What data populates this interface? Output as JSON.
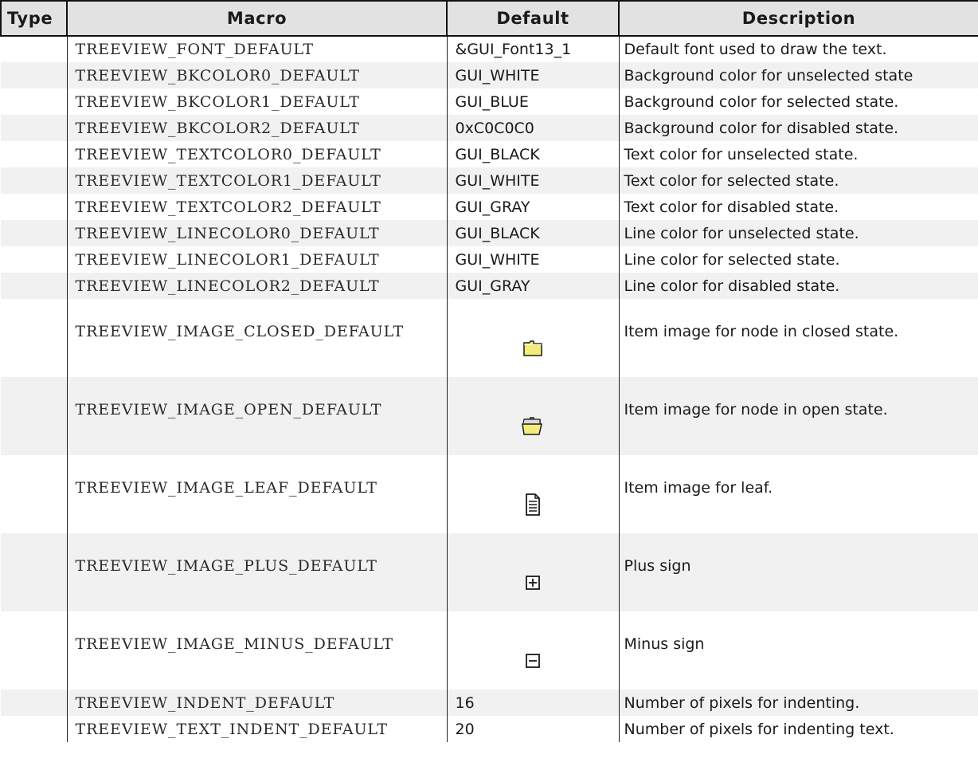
{
  "headers": {
    "type": "Type",
    "macro": "Macro",
    "default": "Default",
    "description": "Description"
  },
  "rows": [
    {
      "type": "",
      "macro": "TREEVIEW_FONT_DEFAULT",
      "default": "&GUI_Font13_1",
      "description": "Default font used to draw the text."
    },
    {
      "type": "",
      "macro": "TREEVIEW_BKCOLOR0_DEFAULT",
      "default": "GUI_WHITE",
      "description": "Background color for unselected state"
    },
    {
      "type": "",
      "macro": "TREEVIEW_BKCOLOR1_DEFAULT",
      "default": "GUI_BLUE",
      "description": "Background color for selected state."
    },
    {
      "type": "",
      "macro": "TREEVIEW_BKCOLOR2_DEFAULT",
      "default": "0xC0C0C0",
      "description": "Background color for disabled state."
    },
    {
      "type": "",
      "macro": "TREEVIEW_TEXTCOLOR0_DEFAULT",
      "default": "GUI_BLACK",
      "description": "Text color for unselected state."
    },
    {
      "type": "",
      "macro": "TREEVIEW_TEXTCOLOR1_DEFAULT",
      "default": "GUI_WHITE",
      "description": "Text color for selected state."
    },
    {
      "type": "",
      "macro": "TREEVIEW_TEXTCOLOR2_DEFAULT",
      "default": "GUI_GRAY",
      "description": "Text color for disabled state."
    },
    {
      "type": "",
      "macro": "TREEVIEW_LINECOLOR0_DEFAULT",
      "default": "GUI_BLACK",
      "description": "Line color for unselected state."
    },
    {
      "type": "",
      "macro": "TREEVIEW_LINECOLOR1_DEFAULT",
      "default": "GUI_WHITE",
      "description": "Line color for selected state."
    },
    {
      "type": "",
      "macro": "TREEVIEW_LINECOLOR2_DEFAULT",
      "default": "GUI_GRAY",
      "description": "Line color for disabled state."
    },
    {
      "type": "",
      "macro": "TREEVIEW_IMAGE_CLOSED_DEFAULT",
      "default_icon": "closed-folder-icon",
      "description": "Item image for node in closed state."
    },
    {
      "type": "",
      "macro": "TREEVIEW_IMAGE_OPEN_DEFAULT",
      "default_icon": "open-folder-icon",
      "description": "Item image for node in open state."
    },
    {
      "type": "",
      "macro": "TREEVIEW_IMAGE_LEAF_DEFAULT",
      "default_icon": "leaf-document-icon",
      "description": "Item image for leaf."
    },
    {
      "type": "",
      "macro": "TREEVIEW_IMAGE_PLUS_DEFAULT",
      "default_icon": "plus-box-icon",
      "description": "Plus sign"
    },
    {
      "type": "",
      "macro": "TREEVIEW_IMAGE_MINUS_DEFAULT",
      "default_icon": "minus-box-icon",
      "description": "Minus sign"
    },
    {
      "type": "",
      "macro": "TREEVIEW_INDENT_DEFAULT",
      "default": "16",
      "description": "Number of pixels for indenting."
    },
    {
      "type": "",
      "macro": "TREEVIEW_TEXT_INDENT_DEFAULT",
      "default": "20",
      "description": "Number of pixels for indenting text."
    }
  ],
  "colors": {
    "header_bg": "#e2e2e2",
    "alt_row_bg": "#f1f1f1",
    "folder_yellow": "#f4ec7a"
  }
}
